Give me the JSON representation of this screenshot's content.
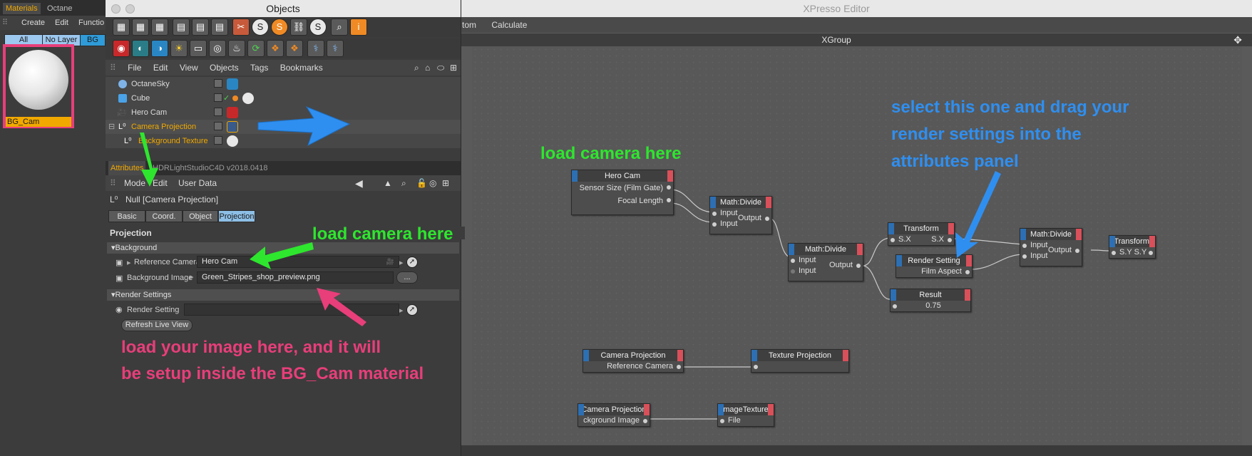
{
  "materials": {
    "tabs": [
      "Materials",
      "Octane Settings"
    ],
    "menu": [
      "Create",
      "Edit",
      "Functio"
    ],
    "filters": [
      "All",
      "No Layer",
      "BG"
    ],
    "material_name": "BG_Cam"
  },
  "objects_window": {
    "title": "Objects",
    "menu": [
      "File",
      "Edit",
      "View",
      "Objects",
      "Tags",
      "Bookmarks"
    ],
    "items": [
      {
        "name": "OctaneSky"
      },
      {
        "name": "Cube"
      },
      {
        "name": "Hero Cam"
      },
      {
        "name": "Camera Projection"
      },
      {
        "name": "Background Texture"
      }
    ]
  },
  "attributes": {
    "tabs": [
      "Attributes",
      "HDRLightStudioC4D v2018.0418"
    ],
    "menu": [
      "Mode",
      "Edit",
      "User Data"
    ],
    "object_label": "Null [Camera Projection]",
    "subtabs": [
      "Basic",
      "Coord.",
      "Object",
      "Projection"
    ],
    "section_title": "Projection",
    "background_group": "Background",
    "reference_camera_label": "Reference Camera",
    "reference_camera_value": "Hero Cam",
    "background_image_label": "Background Image",
    "background_image_value": "Green_Stripes_shop_preview.png",
    "browse_label": "...",
    "render_group": "Render Settings",
    "render_setting_label": "Render Setting",
    "refresh_label": "Refresh Live View"
  },
  "xpresso": {
    "title": "XPresso Editor",
    "menu": [
      "tom",
      "Calculate"
    ],
    "group": "XGroup",
    "nodes": {
      "hero_cam": {
        "title": "Hero Cam",
        "ports": [
          "Sensor Size (Film Gate)",
          "Focal Length"
        ]
      },
      "div1": {
        "title": "Math:Divide",
        "in": [
          "Input",
          "Input"
        ],
        "out": "Output"
      },
      "div2": {
        "title": "Math:Divide",
        "in": [
          "Input",
          "Input"
        ],
        "out": "Output"
      },
      "transform1": {
        "title": "Transform",
        "in": "S.X",
        "out": "S.X"
      },
      "render_setting": {
        "title": "Render Setting",
        "out": "Film Aspect"
      },
      "result": {
        "title": "Result",
        "value": "0.75"
      },
      "div3": {
        "title": "Math:Divide",
        "in": [
          "Input",
          "Input"
        ],
        "out": "Output"
      },
      "transform2": {
        "title": "Transform",
        "port": "S.Y S.Y"
      },
      "cam_proj1": {
        "title": "Camera Projection",
        "port": "Reference Camera"
      },
      "tex_proj": {
        "title": "Texture Projection"
      },
      "cam_proj2": {
        "title": "Camera Projection",
        "port": "ckground Image"
      },
      "image_tex": {
        "title": "mageTexture",
        "port": "File"
      }
    }
  },
  "annotations": {
    "load_camera_top": "load camera here",
    "load_camera_attr": "load camera here",
    "select_render": [
      "select this one and drag your",
      "render settings into the",
      "attributes panel"
    ],
    "load_image": [
      "load your image here, and it will",
      "be setup inside the BG_Cam material"
    ]
  },
  "colors": {
    "pink": "#e83e7a",
    "green": "#2ee62e",
    "blue": "#2f8ff0",
    "orange": "#f1a900"
  }
}
